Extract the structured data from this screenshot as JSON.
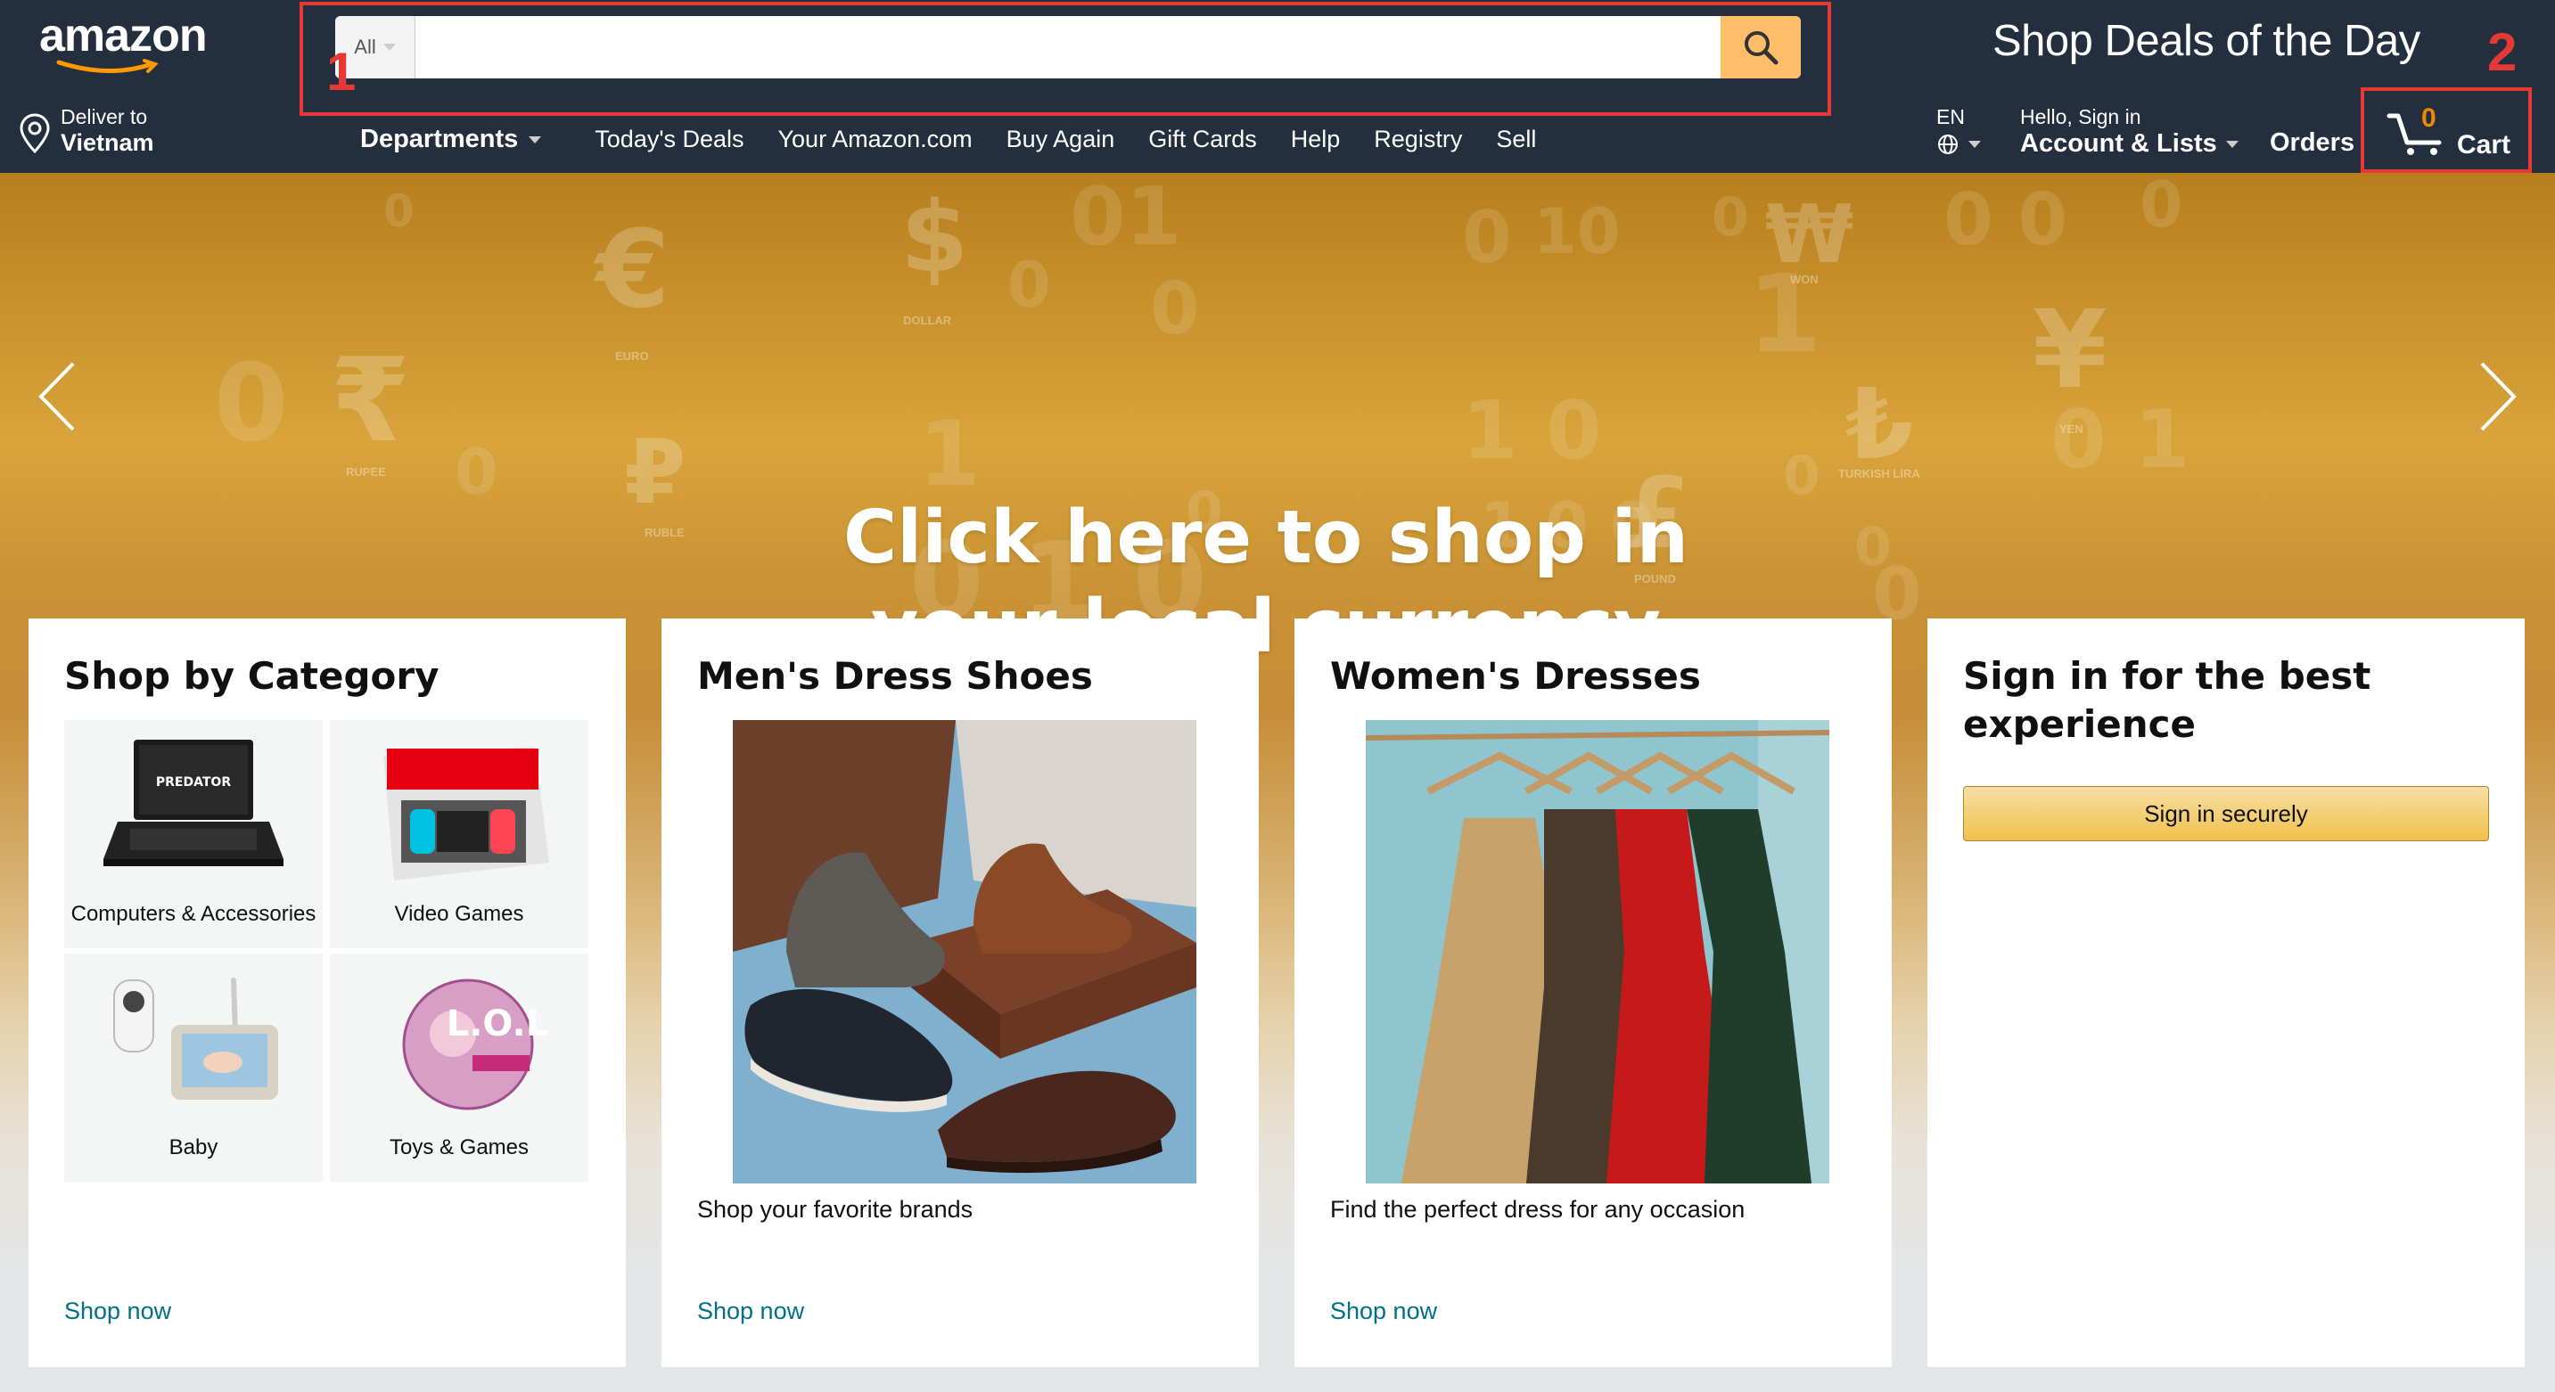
{
  "header": {
    "logo_text": "amazon",
    "deliver_line1": "Deliver to",
    "deliver_line2": "Vietnam",
    "search": {
      "category": "All",
      "placeholder": "",
      "value": ""
    },
    "deals_banner": "Shop Deals of the Day",
    "nav": {
      "departments": "Departments",
      "links": [
        "Today's Deals",
        "Your Amazon.com",
        "Buy Again",
        "Gift Cards",
        "Help",
        "Registry",
        "Sell"
      ]
    },
    "lang": "EN",
    "account_line1": "Hello, Sign in",
    "account_line2": "Account & Lists",
    "orders": "Orders",
    "cart_count": "0",
    "cart_label": "Cart"
  },
  "annotations": {
    "search_marker": "1",
    "cart_marker": "2",
    "color": "#e53935"
  },
  "hero": {
    "headline_line1": "Click here to shop in",
    "headline_line2": "your local currency",
    "currency_labels": [
      "EURO",
      "DOLLAR",
      "RUPEE",
      "RUBLE",
      "POUND",
      "WON",
      "TURKISH LIRA",
      "YEN"
    ]
  },
  "cards": {
    "category": {
      "title": "Shop by Category",
      "tiles": [
        {
          "label": "Computers & Accessories"
        },
        {
          "label": "Video Games"
        },
        {
          "label": "Baby"
        },
        {
          "label": "Toys & Games"
        }
      ],
      "link": "Shop now"
    },
    "shoes": {
      "title": "Men's Dress Shoes",
      "desc": "Shop your favorite brands",
      "link": "Shop now"
    },
    "dresses": {
      "title": "Women's Dresses",
      "desc": "Find the perfect dress for any occasion",
      "link": "Shop now"
    },
    "signin": {
      "title": "Sign in for the best experience",
      "button": "Sign in securely"
    }
  },
  "colors": {
    "header_bg": "#232f3e",
    "search_button": "#febd69",
    "link": "#007185",
    "cart_count": "#f08804"
  }
}
